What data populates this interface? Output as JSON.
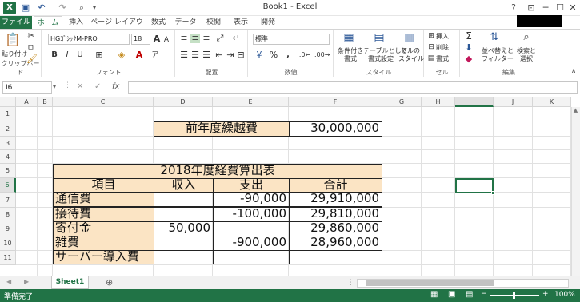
{
  "window": {
    "title": "Book1 - Excel",
    "help": "?",
    "restore_ribbon": "⊡",
    "minimize": "─",
    "maximize": "☐",
    "close": "✕"
  },
  "qat": {
    "save": "💾",
    "undo": "↶",
    "redo": "↷",
    "print_preview": "🔍"
  },
  "tabs": [
    "ファイル",
    "ホーム",
    "挿入",
    "ページ レイアウト",
    "数式",
    "データ",
    "校閲",
    "表示",
    "開発"
  ],
  "ribbon": {
    "clipboard": {
      "paste": "貼り付け",
      "label": "クリップボード"
    },
    "font": {
      "name": "HGｺﾞｼｯｸM-PRO",
      "size": "18",
      "bold": "B",
      "italic": "I",
      "underline": "U",
      "grow": "A",
      "shrink": "A",
      "label": "フォント"
    },
    "alignment": {
      "label": "配置"
    },
    "number": {
      "format": "標準",
      "label": "数値"
    },
    "styles": {
      "conditional": [
        "条件付き",
        "書式"
      ],
      "table": [
        "テーブルとして",
        "書式設定"
      ],
      "cell_styles": [
        "セルの",
        "スタイル"
      ],
      "label": "スタイル"
    },
    "cells": {
      "insert": "挿入",
      "delete": "削除",
      "format": "書式",
      "label": "セル"
    },
    "editing": {
      "sort": [
        "並べ替えと",
        "フィルター"
      ],
      "find": [
        "検索と",
        "選択"
      ],
      "label": "編集"
    }
  },
  "formula_bar": {
    "name_box": "I6",
    "cancel": "✕",
    "enter": "✓",
    "fx": "fx",
    "value": ""
  },
  "columns": [
    "A",
    "B",
    "C",
    "D",
    "E",
    "F",
    "G",
    "H",
    "I",
    "J",
    "K"
  ],
  "rows": [
    "1",
    "2",
    "3",
    "4",
    "5",
    "6",
    "7",
    "8",
    "9",
    "10",
    "11"
  ],
  "selected_column": "I",
  "selected_row": "6",
  "carryover": {
    "label": "前年度繰越費",
    "value": "30,000,000"
  },
  "table": {
    "title": "2018年度経費算出表",
    "headers": [
      "項目",
      "収入",
      "支出",
      "合計"
    ],
    "rows": [
      {
        "item": "通信費",
        "income": "",
        "expense": "-90,000",
        "total": "29,910,000"
      },
      {
        "item": "接待費",
        "income": "",
        "expense": "-100,000",
        "total": "29,810,000"
      },
      {
        "item": "寄付金",
        "income": "50,000",
        "expense": "",
        "total": "29,860,000"
      },
      {
        "item": "雑費",
        "income": "",
        "expense": "-900,000",
        "total": "28,960,000"
      },
      {
        "item": "サーバー導入費",
        "income": "",
        "expense": "",
        "total": ""
      }
    ]
  },
  "sheets": [
    "Sheet1"
  ],
  "add_sheet": "⊕",
  "status": {
    "text": "準備完了",
    "zoom": "100%"
  },
  "colors": {
    "accent": "#217346",
    "fill": "#fbe4c4"
  }
}
